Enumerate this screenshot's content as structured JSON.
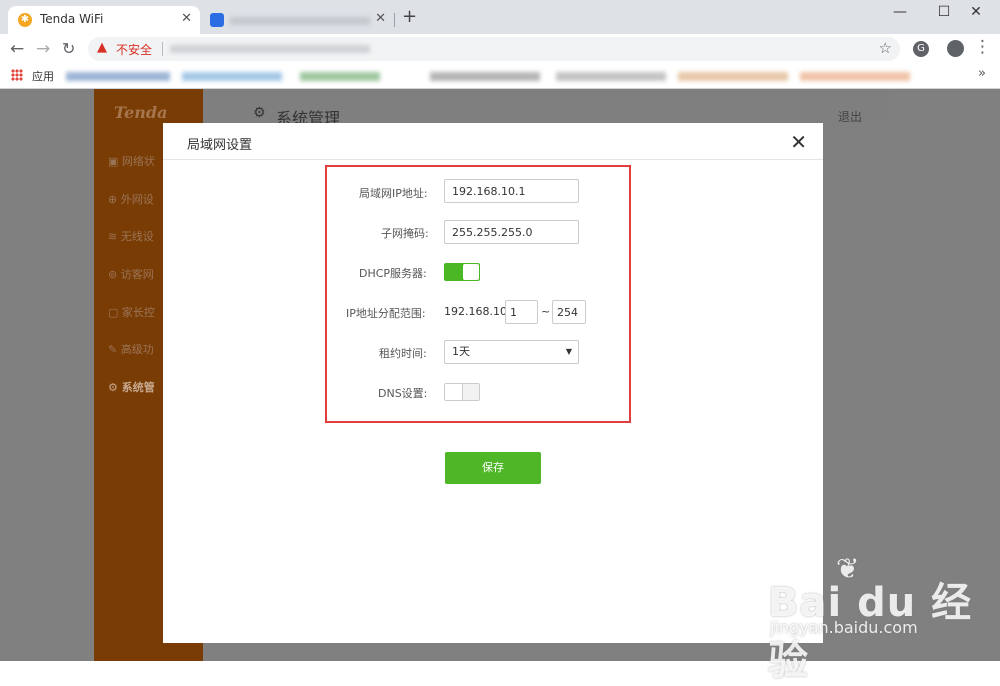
{
  "browser": {
    "active_tab_title": "Tenda WiFi",
    "security_label": "不安全",
    "bookmarks_apps_label": "应用",
    "more_bookmarks": "»"
  },
  "router": {
    "logo": "Tenda",
    "page_title": "系统管理",
    "logout": "退出",
    "sidebar": [
      "网络状",
      "外网设",
      "无线设",
      "访客网",
      "家长控",
      "高级功",
      "系统管"
    ]
  },
  "dialog": {
    "title": "局域网设置",
    "lan_ip_label": "局域网IP地址:",
    "lan_ip_value": "192.168.10.1",
    "subnet_label": "子网掩码:",
    "subnet_value": "255.255.255.0",
    "dhcp_label": "DHCP服务器:",
    "dhcp_enabled": true,
    "range_label": "IP地址分配范围:",
    "range_prefix": "192.168.10.",
    "range_start": "1",
    "range_separator": "~",
    "range_end": "254",
    "lease_label": "租约时间:",
    "lease_value": "1天",
    "dns_label": "DNS设置:",
    "dns_enabled": false,
    "save_label": "保存"
  },
  "watermark": {
    "brand": "Bai du 经验",
    "site": "jingyan.baidu.com"
  },
  "colors": {
    "sidebar": "#7a3c05",
    "toggle_on": "#4cb724",
    "save_button": "#4fb628",
    "highlight_border": "#e43c3c"
  }
}
